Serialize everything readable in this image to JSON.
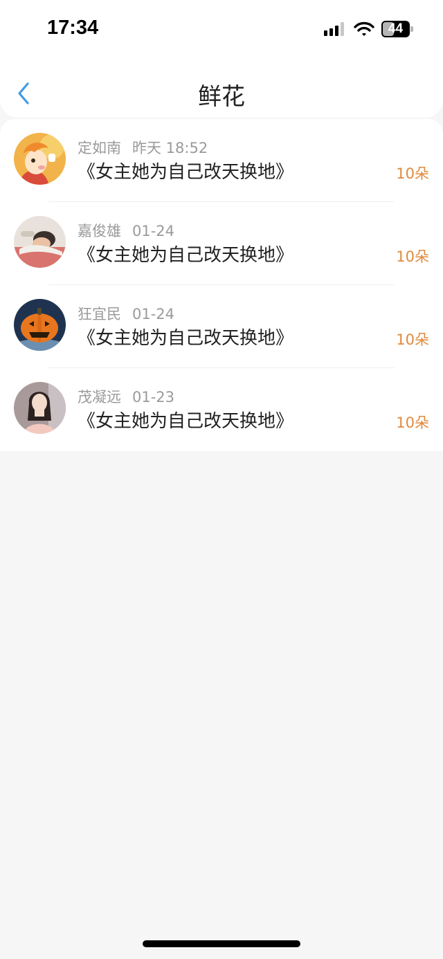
{
  "status_bar": {
    "time": "17:34",
    "battery": "44"
  },
  "header": {
    "title": "鲜花"
  },
  "gifts": [
    {
      "name": "定如南",
      "time": "昨天 18:52",
      "book": "《女主她为自己改天换地》",
      "count": "10朵",
      "avatar": "cartoon-boy-avatar"
    },
    {
      "name": "嘉俊雄",
      "time": "01-24",
      "book": "《女主她为自己改天换地》",
      "count": "10朵",
      "avatar": "sleeping-man-avatar"
    },
    {
      "name": "狂宜民",
      "time": "01-24",
      "book": "《女主她为自己改天换地》",
      "count": "10朵",
      "avatar": "pumpkin-avatar"
    },
    {
      "name": "茂凝远",
      "time": "01-23",
      "book": "《女主她为自己改天换地》",
      "count": "10朵",
      "avatar": "woman-photo-avatar"
    }
  ],
  "colors": {
    "accent": "#e08a3c",
    "back_arrow": "#3f9be8",
    "background": "#f6f6f6"
  }
}
